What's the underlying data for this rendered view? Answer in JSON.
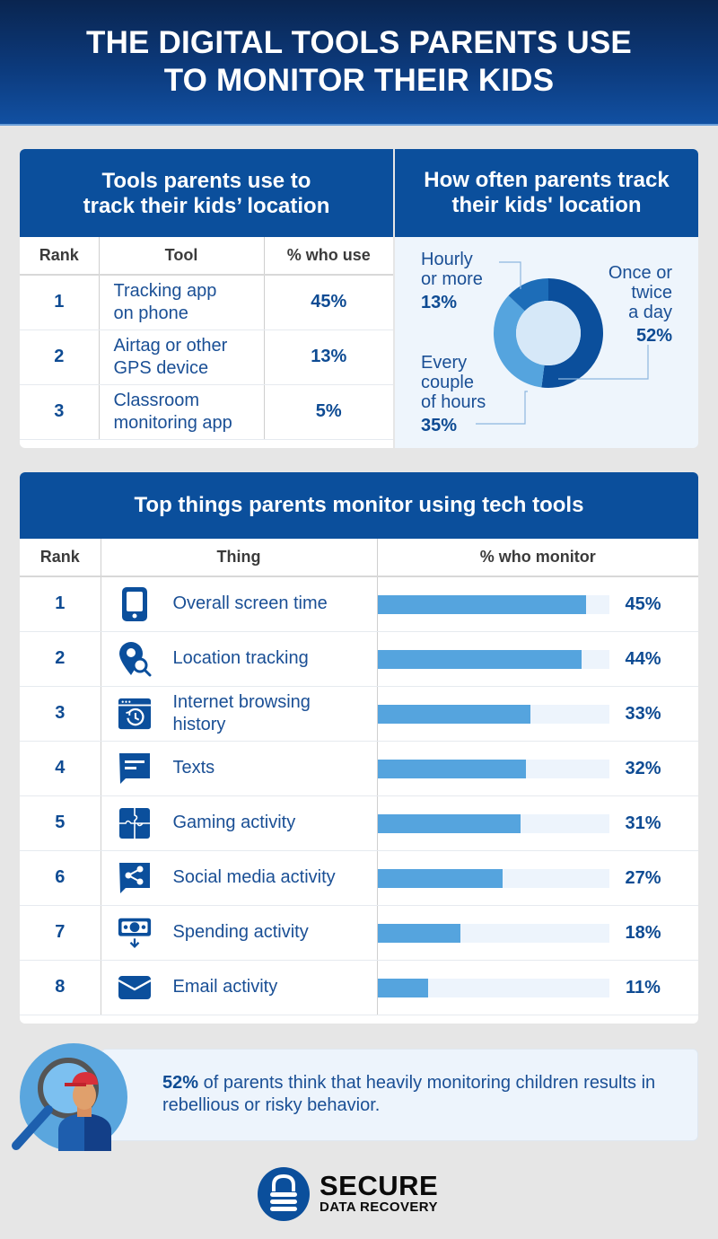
{
  "header": {
    "title_line1": "THE DIGITAL TOOLS PARENTS USE",
    "title_line2": "TO MONITOR THEIR KIDS"
  },
  "colors": {
    "brand_blue": "#0b4f9c",
    "bar_fill": "#55a4de",
    "bar_track": "#edf4fc",
    "donut_dark": "#0b4f9c",
    "donut_mid": "#55a4de",
    "donut_alt": "#1d6db8"
  },
  "tools_table": {
    "title_line1": "Tools parents use to",
    "title_line2": "track their kids’ location",
    "headers": [
      "Rank",
      "Tool",
      "% who use"
    ],
    "rows": [
      {
        "rank": "1",
        "tool_line1": "Tracking app",
        "tool_line2": "on phone",
        "pct": "45%"
      },
      {
        "rank": "2",
        "tool_line1": "Airtag or other",
        "tool_line2": "GPS device",
        "pct": "13%"
      },
      {
        "rank": "3",
        "tool_line1": "Classroom",
        "tool_line2": "monitoring app",
        "pct": "5%"
      }
    ]
  },
  "frequency": {
    "title_line1": "How often parents track",
    "title_line2": "their kids' location",
    "labels": {
      "hourly_line1": "Hourly",
      "hourly_line2": "or more",
      "hourly_pct": "13%",
      "daily_line1": "Once or",
      "daily_line2": "twice",
      "daily_line3": "a day",
      "daily_pct": "52%",
      "couple_line1": "Every",
      "couple_line2": "couple",
      "couple_line3": "of hours",
      "couple_pct": "35%"
    }
  },
  "monitor_table": {
    "title": "Top things parents monitor using tech tools",
    "headers": [
      "Rank",
      "Thing",
      "% who monitor"
    ],
    "rows": [
      {
        "rank": "1",
        "icon": "smartphone-icon",
        "line1": "Overall screen time",
        "line2": "",
        "pct": "45%"
      },
      {
        "rank": "2",
        "icon": "location-search-icon",
        "line1": "Location tracking",
        "line2": "",
        "pct": "44%"
      },
      {
        "rank": "3",
        "icon": "browser-history-icon",
        "line1": "Internet browsing",
        "line2": "history",
        "pct": "33%"
      },
      {
        "rank": "4",
        "icon": "message-icon",
        "line1": "Texts",
        "line2": "",
        "pct": "32%"
      },
      {
        "rank": "5",
        "icon": "puzzle-icon",
        "line1": "Gaming activity",
        "line2": "",
        "pct": "31%"
      },
      {
        "rank": "6",
        "icon": "share-message-icon",
        "line1": "Social media activity",
        "line2": "",
        "pct": "27%"
      },
      {
        "rank": "7",
        "icon": "money-icon",
        "line1": "Spending activity",
        "line2": "",
        "pct": "18%"
      },
      {
        "rank": "8",
        "icon": "envelope-icon",
        "line1": "Email activity",
        "line2": "",
        "pct": "11%"
      }
    ]
  },
  "callout": {
    "highlight": "52%",
    "text": " of parents think that heavily monitoring children results in rebellious or risky behavior."
  },
  "logo": {
    "word1": "SECURE",
    "word2": "DATA RECOVERY"
  },
  "chart_data": [
    {
      "type": "table",
      "title": "Tools parents use to track their kids’ location",
      "columns": [
        "Rank",
        "Tool",
        "% who use"
      ],
      "rows": [
        [
          1,
          "Tracking app on phone",
          45
        ],
        [
          2,
          "Airtag or other GPS device",
          13
        ],
        [
          3,
          "Classroom monitoring app",
          5
        ]
      ]
    },
    {
      "type": "pie",
      "donut": true,
      "title": "How often parents track their kids' location",
      "categories": [
        "Once or twice a day",
        "Every couple of hours",
        "Hourly or more"
      ],
      "values": [
        52,
        35,
        13
      ],
      "unit": "%"
    },
    {
      "type": "bar",
      "orientation": "horizontal",
      "title": "Top things parents monitor using tech tools",
      "categories": [
        "Overall screen time",
        "Location tracking",
        "Internet browsing history",
        "Texts",
        "Gaming activity",
        "Social media activity",
        "Spending activity",
        "Email activity"
      ],
      "values": [
        45,
        44,
        33,
        32,
        31,
        27,
        18,
        11
      ],
      "xlabel": "% who monitor",
      "xlim": [
        0,
        50
      ],
      "unit": "%"
    }
  ]
}
